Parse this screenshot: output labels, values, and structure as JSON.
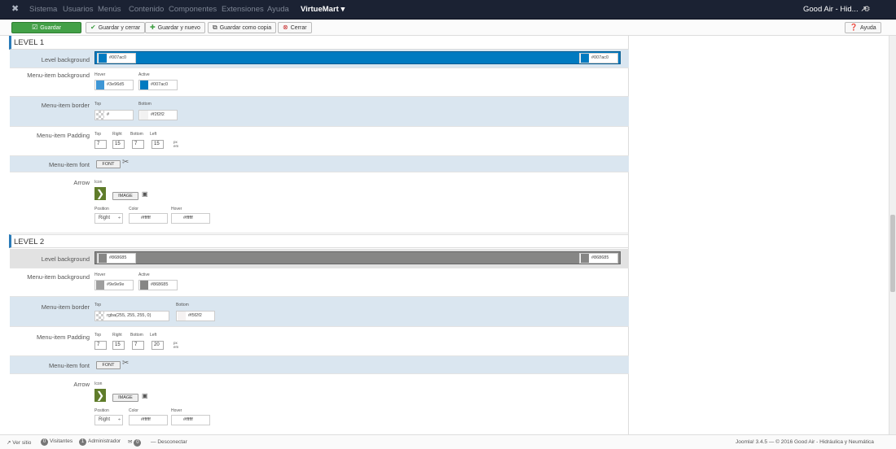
{
  "topbar": {
    "logo": "✖",
    "menu": [
      "Sistema",
      "Usuarios",
      "Menús",
      "Contenido",
      "Componentes",
      "Extensiones",
      "Ayuda"
    ],
    "virtuemart": "VirtueMart ▾",
    "site": "Good Air - Hid... ↗",
    "gear": "⚙"
  },
  "toolbar": {
    "save": "Guardar",
    "save_close": "Guardar y cerrar",
    "save_new": "Guardar y nuevo",
    "save_copy": "Guardar como copia",
    "close": "Cerrar",
    "help": "Ayuda"
  },
  "labels": {
    "level_background": "Level background",
    "menu_item_background": "Menu-item background",
    "menu_item_border": "Menu-item border",
    "menu_item_padding": "Menu-item Padding",
    "menu_item_font": "Menu-item font",
    "arrow": "Arrow",
    "hover": "Hover",
    "active": "Active",
    "top": "Top",
    "bottom": "Bottom",
    "right": "Right",
    "left": "Left",
    "px": "px",
    "em": "em",
    "font_btn": "FONT",
    "icon": "Icon",
    "image_btn": "IMAGE",
    "position": "Position",
    "color": "Color"
  },
  "level1": {
    "title": "LEVEL 1",
    "bg": "#007ac0",
    "bg_color": "#007ac0",
    "hover": "#3e96d5",
    "hover_color": "#3e96d5",
    "active": "#007ac0",
    "active_color": "#007ac0",
    "border_top": "#",
    "border_bottom": "#f2f2f2",
    "pad_top": "7",
    "pad_right": "15",
    "pad_bottom": "7",
    "pad_left": "15",
    "position": "Right",
    "arrow_color": "#ffffff",
    "arrow_hover": "#ffffff"
  },
  "level2": {
    "title": "LEVEL 2",
    "bg": "#868685",
    "bg_color": "#868685",
    "hover": "#9e9e9e",
    "hover_color": "#9e9e9e",
    "active": "#868685",
    "active_color": "#868685",
    "border_top": "rgba(255, 255, 255, 0)",
    "border_bottom": "#f5f2f2",
    "pad_top": "7",
    "pad_right": "15",
    "pad_bottom": "7",
    "pad_left": "20",
    "position": "Right",
    "arrow_color": "#ffffff",
    "arrow_hover": "#ffffff"
  },
  "status": {
    "view_site": "Ver sitio",
    "visitors_count": "0",
    "visitors": "Visitantes",
    "admins_count": "1",
    "admins": "Administrador",
    "msgs_count": "0",
    "logout": "Desconectar",
    "footer": "Joomla! 3.4.5 — © 2016 Good Air - Hidráulica y Neumática"
  }
}
